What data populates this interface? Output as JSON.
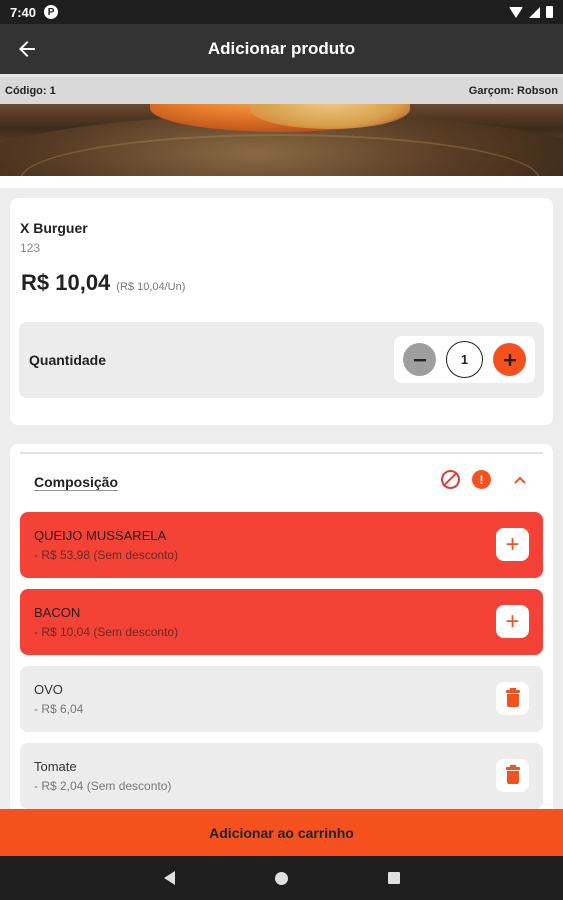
{
  "status_bar": {
    "time": "7:40",
    "notification_letter": "P"
  },
  "app_bar": {
    "title": "Adicionar produto"
  },
  "info_bar": {
    "code": "Código: 1",
    "waiter": "Garçom: Robson"
  },
  "product": {
    "name": "X Burguer",
    "code": "123",
    "price": "R$ 10,04",
    "unit_price": "(R$ 10,04/Un)",
    "quantity_label": "Quantidade",
    "quantity": "1"
  },
  "composition": {
    "title": "Composição",
    "items": [
      {
        "name": "QUEIJO MUSSARELA",
        "price": "- R$ 53,98 (Sem desconto)",
        "state": "added",
        "action": "plus-icon"
      },
      {
        "name": "BACON",
        "price": "- R$ 10,04 (Sem desconto)",
        "state": "added",
        "action": "plus-icon"
      },
      {
        "name": "OVO",
        "price": "- R$ 6,04",
        "state": "default",
        "action": "trash-icon"
      },
      {
        "name": "Tomate",
        "price": "- R$ 2,04 (Sem desconto)",
        "state": "default",
        "action": "trash-icon"
      }
    ]
  },
  "footer": {
    "add_to_cart_label": "Adicionar ao carrinho"
  },
  "colors": {
    "accent": "#f4511e",
    "added_item": "#f44336",
    "app_bar": "#333333"
  }
}
